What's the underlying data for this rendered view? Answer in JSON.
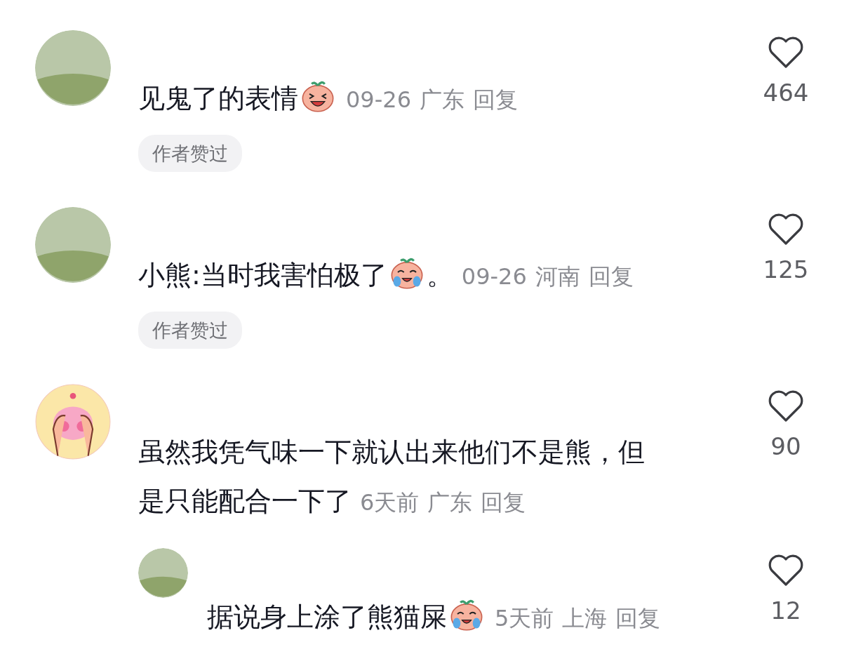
{
  "comments": [
    {
      "avatar": {
        "kind": "photo"
      },
      "body": [
        {
          "kind": "text",
          "text": "见鬼了的表情"
        },
        {
          "kind": "laughing_emoji"
        }
      ],
      "date": "09-26",
      "region": "广东",
      "reply": "回复",
      "badge": "作者赞过",
      "likes": "464"
    },
    {
      "avatar": {
        "kind": "photo"
      },
      "body": [
        {
          "kind": "text",
          "text": "小熊:当时我害怕极了"
        },
        {
          "kind": "crying_emoji"
        },
        {
          "kind": "text",
          "text": "。"
        }
      ],
      "date": "09-26",
      "region": "河南",
      "reply": "回复",
      "badge": "作者赞过",
      "likes": "125"
    },
    {
      "avatar": {
        "kind": "cartoon"
      },
      "body": [
        {
          "kind": "text",
          "text": "虽然我凭气味一下就认出来他们不是熊，但"
        },
        {
          "kind": "text",
          "text": "是只能配合一下了"
        }
      ],
      "date": "6天前",
      "region": "广东",
      "reply": "回复",
      "likes": "90",
      "replies": [
        {
          "avatar": {
            "kind": "photo"
          },
          "body": [
            {
              "kind": "text",
              "text": "据说身上涂了熊猫屎"
            },
            {
              "kind": "crying_emoji"
            }
          ],
          "date": "5天前",
          "region": "上海",
          "reply": "回复",
          "likes": "12"
        }
      ]
    }
  ]
}
